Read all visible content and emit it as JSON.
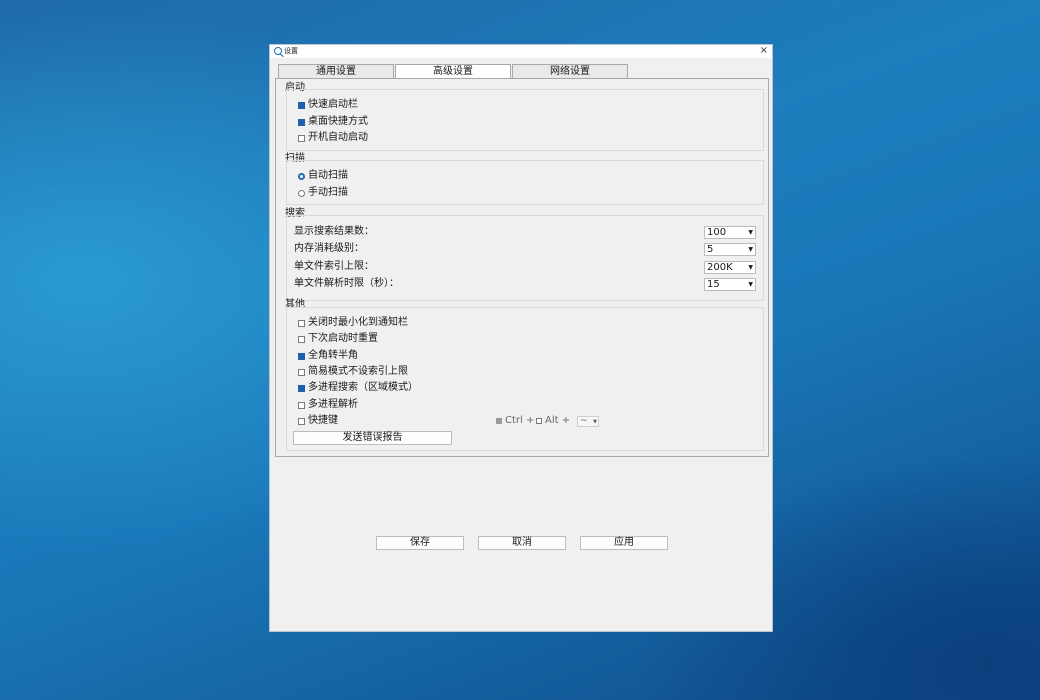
{
  "window": {
    "title": "设置",
    "close": "×"
  },
  "tabs": [
    {
      "label": "通用设置"
    },
    {
      "label": "高级设置"
    },
    {
      "label": "网络设置"
    }
  ],
  "startup": {
    "title": "启动",
    "items": [
      {
        "label": "快速启动栏",
        "checked": true
      },
      {
        "label": "桌面快捷方式",
        "checked": true
      },
      {
        "label": "开机自动启动",
        "checked": false
      }
    ]
  },
  "scan": {
    "title": "扫描",
    "options": [
      {
        "label": "自动扫描",
        "selected": true
      },
      {
        "label": "手动扫描",
        "selected": false
      }
    ]
  },
  "search": {
    "title": "搜索",
    "rows": [
      {
        "label": "显示搜索结果数：",
        "value": "100"
      },
      {
        "label": "内存消耗级别：",
        "value": "5"
      },
      {
        "label": "单文件索引上限：",
        "value": "200K"
      },
      {
        "label": "单文件解析时限（秒）：",
        "value": "15"
      }
    ]
  },
  "other": {
    "title": "其他",
    "items": [
      {
        "label": "关闭时最小化到通知栏",
        "checked": false
      },
      {
        "label": "下次启动时重置",
        "checked": false
      },
      {
        "label": "全角转半角",
        "checked": true
      },
      {
        "label": "简易模式不设索引上限",
        "checked": false
      },
      {
        "label": "多进程搜索（区域模式）",
        "checked": true
      },
      {
        "label": "多进程解析",
        "checked": false
      },
      {
        "label": "快捷键",
        "checked": false
      }
    ],
    "hotkey": {
      "ctrl": "Ctrl +",
      "alt": "Alt +",
      "key": "~"
    },
    "report_button": "发送错误报告"
  },
  "footer": {
    "save": "保存",
    "cancel": "取消",
    "apply": "应用"
  },
  "colors": {
    "accent": "#1f5fae",
    "window_bg": "#f0f0f0"
  },
  "icons": {
    "app": "search-icon",
    "close": "close-icon",
    "dropdown": "chevron-down-icon"
  }
}
